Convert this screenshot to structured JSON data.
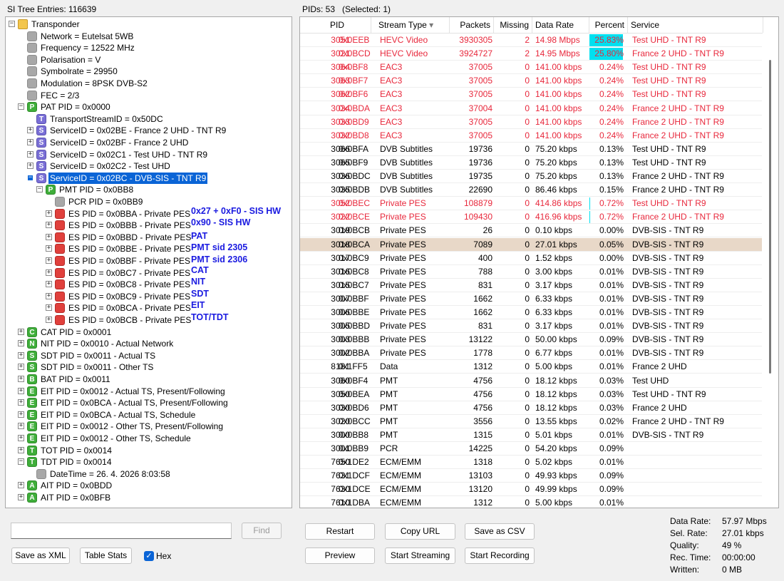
{
  "left_header": "SI Tree Entries: 116639",
  "right_header": "PIDs: 53   (Selected: 1)",
  "tree": [
    {
      "indent": 0,
      "exp": "-",
      "icon": "folder",
      "letter": "",
      "label": "Transponder"
    },
    {
      "indent": 1,
      "exp": "",
      "icon": "gray",
      "letter": "",
      "label": "Network = Eutelsat 5WB"
    },
    {
      "indent": 1,
      "exp": "",
      "icon": "gray",
      "letter": "",
      "label": "Frequency = 12522 MHz"
    },
    {
      "indent": 1,
      "exp": "",
      "icon": "gray",
      "letter": "",
      "label": "Polarisation = V"
    },
    {
      "indent": 1,
      "exp": "",
      "icon": "gray",
      "letter": "",
      "label": "Symbolrate = 29950"
    },
    {
      "indent": 1,
      "exp": "",
      "icon": "gray",
      "letter": "",
      "label": "Modulation = 8PSK DVB-S2"
    },
    {
      "indent": 1,
      "exp": "",
      "icon": "gray",
      "letter": "",
      "label": "FEC = 2/3"
    },
    {
      "indent": 1,
      "exp": "-",
      "icon": "green",
      "letter": "P",
      "label": "PAT PID = 0x0000"
    },
    {
      "indent": 2,
      "exp": "",
      "icon": "purple",
      "letter": "T",
      "label": "TransportStreamID = 0x50DC"
    },
    {
      "indent": 2,
      "exp": "+",
      "icon": "purple",
      "letter": "S",
      "label": "ServiceID = 0x02BE - France 2 UHD - TNT R9"
    },
    {
      "indent": 2,
      "exp": "+",
      "icon": "purple",
      "letter": "S",
      "label": "ServiceID = 0x02BF - France 2 UHD"
    },
    {
      "indent": 2,
      "exp": "+",
      "icon": "purple",
      "letter": "S",
      "label": "ServiceID = 0x02C1 - Test UHD - TNT R9"
    },
    {
      "indent": 2,
      "exp": "+",
      "icon": "purple",
      "letter": "S",
      "label": "ServiceID = 0x02C2 - Test UHD"
    },
    {
      "indent": 2,
      "exp": "-",
      "icon": "purple",
      "letter": "S",
      "label": "ServiceID = 0x02BC - DVB-SIS - TNT R9",
      "selected": true
    },
    {
      "indent": 3,
      "exp": "-",
      "icon": "green",
      "letter": "P",
      "label": "PMT PID = 0x0BB8"
    },
    {
      "indent": 4,
      "exp": "",
      "icon": "gray",
      "letter": "",
      "label": "PCR PID = 0x0BB9"
    },
    {
      "indent": 4,
      "exp": "+",
      "icon": "red",
      "letter": "",
      "label": "ES PID = 0x0BBA - Private PES",
      "annot": "0x27 + 0xF0 - SIS HW"
    },
    {
      "indent": 4,
      "exp": "+",
      "icon": "red",
      "letter": "",
      "label": "ES PID = 0x0BBB - Private PES",
      "annot": "0x90 - SIS HW"
    },
    {
      "indent": 4,
      "exp": "+",
      "icon": "red",
      "letter": "",
      "label": "ES PID = 0x0BBD - Private PES",
      "annot": "PAT"
    },
    {
      "indent": 4,
      "exp": "+",
      "icon": "red",
      "letter": "",
      "label": "ES PID = 0x0BBE - Private PES",
      "annot": "PMT  sid 2305"
    },
    {
      "indent": 4,
      "exp": "+",
      "icon": "red",
      "letter": "",
      "label": "ES PID = 0x0BBF - Private PES",
      "annot": "PMT  sid 2306"
    },
    {
      "indent": 4,
      "exp": "+",
      "icon": "red",
      "letter": "",
      "label": "ES PID = 0x0BC7 - Private PES",
      "annot": "CAT"
    },
    {
      "indent": 4,
      "exp": "+",
      "icon": "red",
      "letter": "",
      "label": "ES PID = 0x0BC8 - Private PES",
      "annot": "NIT"
    },
    {
      "indent": 4,
      "exp": "+",
      "icon": "red",
      "letter": "",
      "label": "ES PID = 0x0BC9 - Private PES",
      "annot": "SDT"
    },
    {
      "indent": 4,
      "exp": "+",
      "icon": "red",
      "letter": "",
      "label": "ES PID = 0x0BCA - Private PES",
      "annot": "EIT"
    },
    {
      "indent": 4,
      "exp": "+",
      "icon": "red",
      "letter": "",
      "label": "ES PID = 0x0BCB - Private PES",
      "annot": "TOT/TDT"
    },
    {
      "indent": 1,
      "exp": "+",
      "icon": "green",
      "letter": "C",
      "label": "CAT PID = 0x0001"
    },
    {
      "indent": 1,
      "exp": "+",
      "icon": "green",
      "letter": "N",
      "label": "NIT PID = 0x0010 - Actual Network"
    },
    {
      "indent": 1,
      "exp": "+",
      "icon": "green",
      "letter": "S",
      "label": "SDT PID = 0x0011 - Actual TS"
    },
    {
      "indent": 1,
      "exp": "+",
      "icon": "green",
      "letter": "S",
      "label": "SDT PID = 0x0011 - Other TS"
    },
    {
      "indent": 1,
      "exp": "+",
      "icon": "green",
      "letter": "B",
      "label": "BAT PID = 0x0011"
    },
    {
      "indent": 1,
      "exp": "+",
      "icon": "green",
      "letter": "E",
      "label": "EIT PID = 0x0012 - Actual TS, Present/Following"
    },
    {
      "indent": 1,
      "exp": "+",
      "icon": "green",
      "letter": "E",
      "label": "EIT PID = 0x0BCA - Actual TS, Present/Following"
    },
    {
      "indent": 1,
      "exp": "+",
      "icon": "green",
      "letter": "E",
      "label": "EIT PID = 0x0BCA - Actual TS, Schedule"
    },
    {
      "indent": 1,
      "exp": "+",
      "icon": "green",
      "letter": "E",
      "label": "EIT PID = 0x0012 - Other TS, Present/Following"
    },
    {
      "indent": 1,
      "exp": "+",
      "icon": "green",
      "letter": "E",
      "label": "EIT PID = 0x0012 - Other TS, Schedule"
    },
    {
      "indent": 1,
      "exp": "+",
      "icon": "green",
      "letter": "T",
      "label": "TOT PID = 0x0014"
    },
    {
      "indent": 1,
      "exp": "-",
      "icon": "green",
      "letter": "T",
      "label": "TDT PID = 0x0014"
    },
    {
      "indent": 2,
      "exp": "",
      "icon": "gray",
      "letter": "",
      "label": "DateTime = 26. 4. 2026 8:03:58"
    },
    {
      "indent": 1,
      "exp": "+",
      "icon": "green",
      "letter": "A",
      "label": "AIT PID = 0x0BDD"
    },
    {
      "indent": 1,
      "exp": "+",
      "icon": "green",
      "letter": "A",
      "label": "AIT PID = 0x0BFB"
    }
  ],
  "columns": [
    "PID",
    "Stream Type",
    "Packets",
    "Missing",
    "Data Rate",
    "Percent",
    "Service"
  ],
  "rows": [
    {
      "pid": "3051",
      "hex": "0x0EEB",
      "type": "HEVC Video",
      "packets": "3930305",
      "missing": "2",
      "rate": "14.98 Mbps",
      "pct": "25.83%",
      "pct_val": 25.83,
      "service": "Test UHD - TNT R9",
      "red": true
    },
    {
      "pid": "3021",
      "hex": "0x0BCD",
      "type": "HEVC Video",
      "packets": "3924727",
      "missing": "2",
      "rate": "14.95 Mbps",
      "pct": "25.80%",
      "pct_val": 25.8,
      "service": "France 2 UHD - TNT R9",
      "red": true
    },
    {
      "pid": "3064",
      "hex": "0x0BF8",
      "type": "EAC3",
      "packets": "37005",
      "missing": "0",
      "rate": "141.00 kbps",
      "pct": "0.24%",
      "pct_val": 0.24,
      "service": "Test UHD - TNT R9",
      "red": true
    },
    {
      "pid": "3063",
      "hex": "0x0BF7",
      "type": "EAC3",
      "packets": "37005",
      "missing": "0",
      "rate": "141.00 kbps",
      "pct": "0.24%",
      "pct_val": 0.24,
      "service": "Test UHD - TNT R9",
      "red": true
    },
    {
      "pid": "3062",
      "hex": "0x0BF6",
      "type": "EAC3",
      "packets": "37005",
      "missing": "0",
      "rate": "141.00 kbps",
      "pct": "0.24%",
      "pct_val": 0.24,
      "service": "Test UHD - TNT R9",
      "red": true
    },
    {
      "pid": "3034",
      "hex": "0x0BDA",
      "type": "EAC3",
      "packets": "37004",
      "missing": "0",
      "rate": "141.00 kbps",
      "pct": "0.24%",
      "pct_val": 0.24,
      "service": "France 2 UHD - TNT R9",
      "red": true
    },
    {
      "pid": "3033",
      "hex": "0x0BD9",
      "type": "EAC3",
      "packets": "37005",
      "missing": "0",
      "rate": "141.00 kbps",
      "pct": "0.24%",
      "pct_val": 0.24,
      "service": "France 2 UHD - TNT R9",
      "red": true
    },
    {
      "pid": "3032",
      "hex": "0x0BD8",
      "type": "EAC3",
      "packets": "37005",
      "missing": "0",
      "rate": "141.00 kbps",
      "pct": "0.24%",
      "pct_val": 0.24,
      "service": "France 2 UHD - TNT R9",
      "red": true
    },
    {
      "pid": "3066",
      "hex": "0x0BFA",
      "type": "DVB Subtitles",
      "packets": "19736",
      "missing": "0",
      "rate": "75.20 kbps",
      "pct": "0.13%",
      "pct_val": 0.13,
      "service": "Test UHD - TNT R9"
    },
    {
      "pid": "3065",
      "hex": "0x0BF9",
      "type": "DVB Subtitles",
      "packets": "19736",
      "missing": "0",
      "rate": "75.20 kbps",
      "pct": "0.13%",
      "pct_val": 0.13,
      "service": "Test UHD - TNT R9"
    },
    {
      "pid": "3036",
      "hex": "0x0BDC",
      "type": "DVB Subtitles",
      "packets": "19735",
      "missing": "0",
      "rate": "75.20 kbps",
      "pct": "0.13%",
      "pct_val": 0.13,
      "service": "France 2 UHD - TNT R9"
    },
    {
      "pid": "3035",
      "hex": "0x0BDB",
      "type": "DVB Subtitles",
      "packets": "22690",
      "missing": "0",
      "rate": "86.46 kbps",
      "pct": "0.15%",
      "pct_val": 0.15,
      "service": "France 2 UHD - TNT R9"
    },
    {
      "pid": "3052",
      "hex": "0x0BEC",
      "type": "Private PES",
      "packets": "108879",
      "missing": "0",
      "rate": "414.86 kbps",
      "pct": "0.72%",
      "pct_val": 0.72,
      "service": "Test UHD - TNT R9",
      "red": true
    },
    {
      "pid": "3022",
      "hex": "0x0BCE",
      "type": "Private PES",
      "packets": "109430",
      "missing": "0",
      "rate": "416.96 kbps",
      "pct": "0.72%",
      "pct_val": 0.72,
      "service": "France 2 UHD - TNT R9",
      "red": true
    },
    {
      "pid": "3019",
      "hex": "0x0BCB",
      "type": "Private PES",
      "packets": "26",
      "missing": "0",
      "rate": "0.10 kbps",
      "pct": "0.00%",
      "pct_val": 0.0,
      "service": "DVB-SIS - TNT R9"
    },
    {
      "pid": "3018",
      "hex": "0x0BCA",
      "type": "Private PES",
      "packets": "7089",
      "missing": "0",
      "rate": "27.01 kbps",
      "pct": "0.05%",
      "pct_val": 0.05,
      "service": "DVB-SIS - TNT R9",
      "hl": true
    },
    {
      "pid": "3017",
      "hex": "0x0BC9",
      "type": "Private PES",
      "packets": "400",
      "missing": "0",
      "rate": "1.52 kbps",
      "pct": "0.00%",
      "pct_val": 0.0,
      "service": "DVB-SIS - TNT R9"
    },
    {
      "pid": "3016",
      "hex": "0x0BC8",
      "type": "Private PES",
      "packets": "788",
      "missing": "0",
      "rate": "3.00 kbps",
      "pct": "0.01%",
      "pct_val": 0.01,
      "service": "DVB-SIS - TNT R9"
    },
    {
      "pid": "3015",
      "hex": "0x0BC7",
      "type": "Private PES",
      "packets": "831",
      "missing": "0",
      "rate": "3.17 kbps",
      "pct": "0.01%",
      "pct_val": 0.01,
      "service": "DVB-SIS - TNT R9"
    },
    {
      "pid": "3007",
      "hex": "0x0BBF",
      "type": "Private PES",
      "packets": "1662",
      "missing": "0",
      "rate": "6.33 kbps",
      "pct": "0.01%",
      "pct_val": 0.01,
      "service": "DVB-SIS - TNT R9"
    },
    {
      "pid": "3006",
      "hex": "0x0BBE",
      "type": "Private PES",
      "packets": "1662",
      "missing": "0",
      "rate": "6.33 kbps",
      "pct": "0.01%",
      "pct_val": 0.01,
      "service": "DVB-SIS - TNT R9"
    },
    {
      "pid": "3005",
      "hex": "0x0BBD",
      "type": "Private PES",
      "packets": "831",
      "missing": "0",
      "rate": "3.17 kbps",
      "pct": "0.01%",
      "pct_val": 0.01,
      "service": "DVB-SIS - TNT R9"
    },
    {
      "pid": "3003",
      "hex": "0x0BBB",
      "type": "Private PES",
      "packets": "13122",
      "missing": "0",
      "rate": "50.00 kbps",
      "pct": "0.09%",
      "pct_val": 0.09,
      "service": "DVB-SIS - TNT R9"
    },
    {
      "pid": "3002",
      "hex": "0x0BBA",
      "type": "Private PES",
      "packets": "1778",
      "missing": "0",
      "rate": "6.77 kbps",
      "pct": "0.01%",
      "pct_val": 0.01,
      "service": "DVB-SIS - TNT R9"
    },
    {
      "pid": "8181",
      "hex": "0x1FF5",
      "type": "Data",
      "packets": "1312",
      "missing": "0",
      "rate": "5.00 kbps",
      "pct": "0.01%",
      "pct_val": 0.01,
      "service": "France 2 UHD"
    },
    {
      "pid": "3060",
      "hex": "0x0BF4",
      "type": "PMT",
      "packets": "4756",
      "missing": "0",
      "rate": "18.12 kbps",
      "pct": "0.03%",
      "pct_val": 0.03,
      "service": "Test UHD"
    },
    {
      "pid": "3050",
      "hex": "0x0BEA",
      "type": "PMT",
      "packets": "4756",
      "missing": "0",
      "rate": "18.12 kbps",
      "pct": "0.03%",
      "pct_val": 0.03,
      "service": "Test UHD - TNT R9"
    },
    {
      "pid": "3030",
      "hex": "0x0BD6",
      "type": "PMT",
      "packets": "4756",
      "missing": "0",
      "rate": "18.12 kbps",
      "pct": "0.03%",
      "pct_val": 0.03,
      "service": "France 2 UHD"
    },
    {
      "pid": "3020",
      "hex": "0x0BCC",
      "type": "PMT",
      "packets": "3556",
      "missing": "0",
      "rate": "13.55 kbps",
      "pct": "0.02%",
      "pct_val": 0.02,
      "service": "France 2 UHD - TNT R9"
    },
    {
      "pid": "3000",
      "hex": "0x0BB8",
      "type": "PMT",
      "packets": "1315",
      "missing": "0",
      "rate": "5.01 kbps",
      "pct": "0.01%",
      "pct_val": 0.01,
      "service": "DVB-SIS - TNT R9"
    },
    {
      "pid": "3001",
      "hex": "0x0BB9",
      "type": "PCR",
      "packets": "14225",
      "missing": "0",
      "rate": "54.20 kbps",
      "pct": "0.09%",
      "pct_val": 0.09,
      "service": ""
    },
    {
      "pid": "7650",
      "hex": "0x1DE2",
      "type": "ECM/EMM",
      "packets": "1318",
      "missing": "0",
      "rate": "5.02 kbps",
      "pct": "0.01%",
      "pct_val": 0.01,
      "service": ""
    },
    {
      "pid": "7631",
      "hex": "0x1DCF",
      "type": "ECM/EMM",
      "packets": "13103",
      "missing": "0",
      "rate": "49.93 kbps",
      "pct": "0.09%",
      "pct_val": 0.09,
      "service": ""
    },
    {
      "pid": "7630",
      "hex": "0x1DCE",
      "type": "ECM/EMM",
      "packets": "13120",
      "missing": "0",
      "rate": "49.99 kbps",
      "pct": "0.09%",
      "pct_val": 0.09,
      "service": ""
    },
    {
      "pid": "7610",
      "hex": "0x1DBA",
      "type": "ECM/EMM",
      "packets": "1312",
      "missing": "0",
      "rate": "5.00 kbps",
      "pct": "0.01%",
      "pct_val": 0.01,
      "service": ""
    }
  ],
  "left_controls": {
    "search_value": "",
    "find": "Find",
    "save_xml": "Save as XML",
    "table_stats": "Table Stats",
    "hex_label": "Hex",
    "hex_checked": true
  },
  "buttons": {
    "restart": "Restart",
    "copy_url": "Copy URL",
    "save_csv": "Save as CSV",
    "preview": "Preview",
    "start_streaming": "Start Streaming",
    "start_recording": "Start Recording"
  },
  "stats": [
    {
      "key": "Data Rate:",
      "value": "57.97 Mbps"
    },
    {
      "key": "Sel. Rate:",
      "value": "27.01 kbps"
    },
    {
      "key": "Quality:",
      "value": "49 %"
    },
    {
      "key": "Rec. Time:",
      "value": "00:00:00"
    },
    {
      "key": "Written:",
      "value": "0 MB"
    }
  ],
  "colors": {
    "selection": "#0a64d6",
    "row_highlight": "#e8d8c8",
    "red_text": "#e8283c",
    "percent_bar": "#00e0f0",
    "annotation": "#1a1ae0"
  }
}
